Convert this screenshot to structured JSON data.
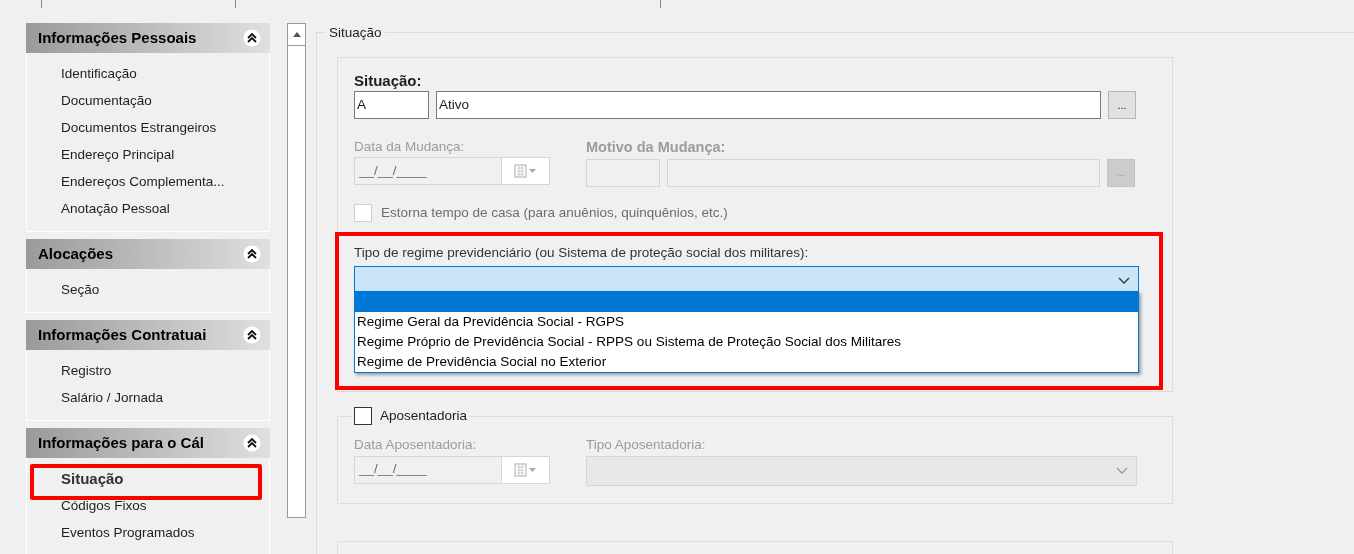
{
  "sidebar": {
    "sections": [
      {
        "title": "Informações Pessoais",
        "expanded": true,
        "items": [
          {
            "label": "Identificação",
            "selected": false,
            "highlighted": false
          },
          {
            "label": "Documentação",
            "selected": false,
            "highlighted": false
          },
          {
            "label": "Documentos Estrangeiros",
            "selected": false,
            "highlighted": false
          },
          {
            "label": "Endereço Principal",
            "selected": false,
            "highlighted": false
          },
          {
            "label": "Endereços Complementa...",
            "selected": false,
            "highlighted": false
          },
          {
            "label": "Anotação Pessoal",
            "selected": false,
            "highlighted": false
          }
        ]
      },
      {
        "title": "Alocações",
        "expanded": true,
        "items": [
          {
            "label": "Seção",
            "selected": false,
            "highlighted": false
          }
        ]
      },
      {
        "title": "Informações Contratuai",
        "expanded": true,
        "items": [
          {
            "label": "Registro",
            "selected": false,
            "highlighted": false
          },
          {
            "label": "Salário / Jornada",
            "selected": false,
            "highlighted": false
          }
        ]
      },
      {
        "title": "Informações para o Cál",
        "expanded": true,
        "items": [
          {
            "label": "Situação",
            "selected": true,
            "highlighted": true
          },
          {
            "label": "Códigos Fixos",
            "selected": false,
            "highlighted": false
          },
          {
            "label": "Eventos Programados",
            "selected": false,
            "highlighted": false
          }
        ]
      }
    ]
  },
  "group_title": "Situação",
  "situacao": {
    "label": "Situação:",
    "code": "A",
    "name": "Ativo",
    "browse": "..."
  },
  "data_mudanca": {
    "label": "Data da Mudança:",
    "value": "__/__/____",
    "disabled": true
  },
  "motivo_mudanca": {
    "label": "Motivo da Mudança:",
    "browse": "...",
    "disabled": true
  },
  "estorna": {
    "label": "Estorna tempo de casa (para anuênios, quinquênios, etc.)",
    "checked": false,
    "disabled": true
  },
  "regime": {
    "label": "Tipo de regime previdenciário (ou Sistema de proteção social dos militares):",
    "expanded": true,
    "highlighted": true,
    "options": [
      {
        "selected": true
      },
      {
        "label": "Regime Geral da Previdência Social - RGPS",
        "selected": false
      },
      {
        "label": "Regime Próprio de Previdência Social - RPPS ou Sistema de Proteção Social dos Militares",
        "selected": false
      },
      {
        "label": "Regime de Previdência Social no Exterior",
        "selected": false
      }
    ]
  },
  "aposentadoria": {
    "label": "Aposentadoria",
    "checked": false,
    "data_label": "Data Aposentadoria:",
    "data_value": "__/__/____",
    "tipo_label": "Tipo Aposentadoria:",
    "disabled": true
  }
}
